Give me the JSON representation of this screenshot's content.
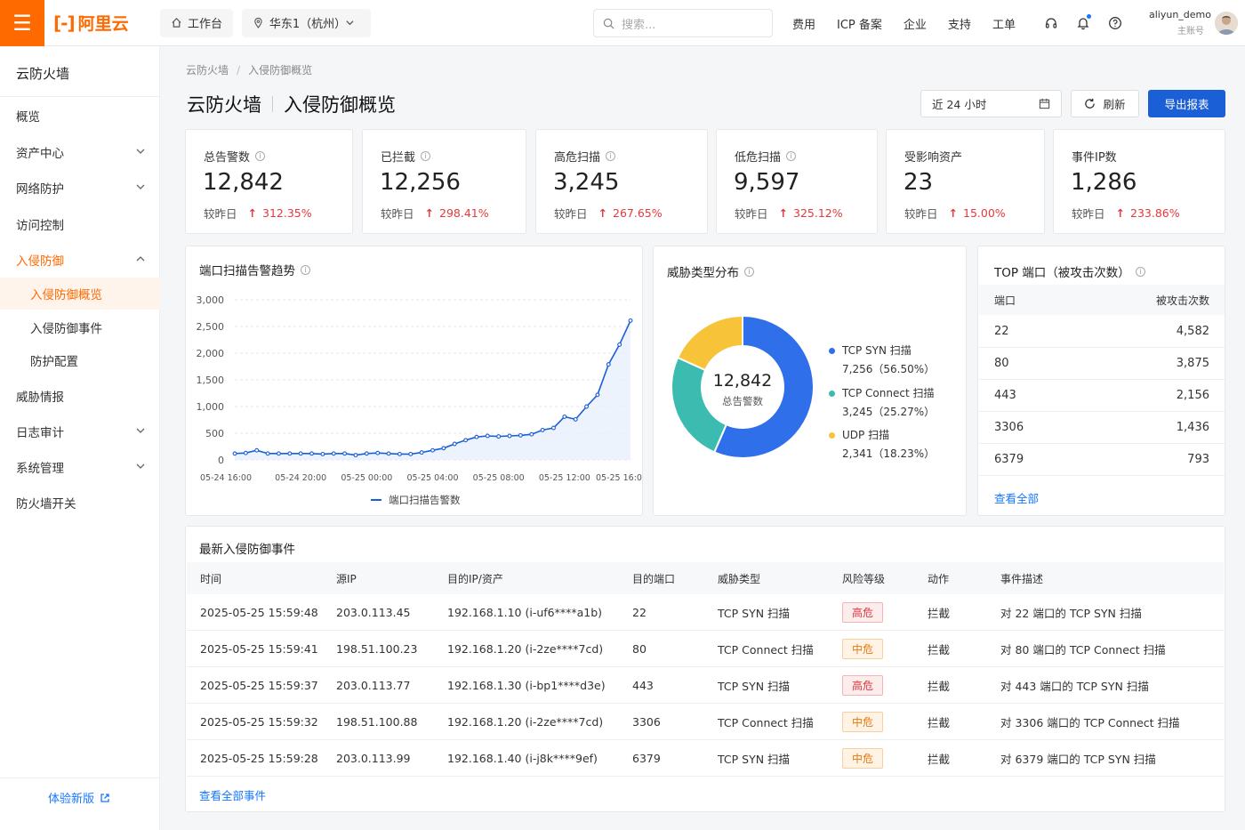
{
  "topbar": {
    "brand": "阿里云",
    "workbench": "工作台",
    "region": "华东1（杭州）",
    "search_placeholder": "搜索...",
    "nav": [
      "费用",
      "ICP 备案",
      "企业",
      "支持",
      "工单"
    ],
    "username": "aliyun_demo",
    "role": "主账号"
  },
  "sidebar": {
    "title": "云防火墙",
    "items": [
      {
        "label": "概览",
        "chevron": false
      },
      {
        "label": "资产中心",
        "chevron": true
      },
      {
        "label": "网络防护",
        "chevron": true
      },
      {
        "label": "访问控制",
        "chevron": false
      },
      {
        "label": "入侵防御",
        "chevron": true,
        "expanded": true
      },
      {
        "label": "入侵防御概览",
        "sub": true,
        "active": true
      },
      {
        "label": "入侵防御事件",
        "sub": true
      },
      {
        "label": "防护配置",
        "sub": true
      },
      {
        "label": "威胁情报",
        "chevron": false
      },
      {
        "label": "日志审计",
        "chevron": true
      },
      {
        "label": "系统管理",
        "chevron": true
      },
      {
        "label": "防火墙开关",
        "chevron": false
      }
    ],
    "new_version": "体验新版"
  },
  "breadcrumb": {
    "root": "云防火墙",
    "sep": "/",
    "current": "入侵防御概览"
  },
  "page_title": {
    "main": "云防火墙",
    "sub": "入侵防御概览"
  },
  "toolbar": {
    "range": "近 24 小时",
    "refresh": "刷新",
    "export": "导出报表"
  },
  "stats": [
    {
      "label": "总告警数",
      "info": true,
      "value": "12,842",
      "cmp": "较昨日",
      "change": "312.35%"
    },
    {
      "label": "已拦截",
      "info": true,
      "value": "12,256",
      "cmp": "较昨日",
      "change": "298.41%"
    },
    {
      "label": "高危扫描",
      "info": true,
      "value": "3,245",
      "cmp": "较昨日",
      "change": "267.65%"
    },
    {
      "label": "低危扫描",
      "info": true,
      "value": "9,597",
      "cmp": "较昨日",
      "change": "325.12%"
    },
    {
      "label": "受影响资产",
      "info": false,
      "value": "23",
      "cmp": "较昨日",
      "change": "15.00%"
    },
    {
      "label": "事件IP数",
      "info": false,
      "value": "1,286",
      "cmp": "较昨日",
      "change": "233.86%"
    }
  ],
  "trend": {
    "title": "端口扫描告警趋势"
  },
  "pie": {
    "title": "威胁类型分布",
    "center_value": "12,842",
    "center_label": "总告警数"
  },
  "top_ports": {
    "title": "TOP 端口（被攻击次数）",
    "col_port": "端口",
    "col_count": "被攻击次数",
    "rows": [
      {
        "port": "22",
        "count": "4,582"
      },
      {
        "port": "80",
        "count": "3,875"
      },
      {
        "port": "443",
        "count": "2,156"
      },
      {
        "port": "3306",
        "count": "1,436"
      },
      {
        "port": "6379",
        "count": "793"
      }
    ],
    "view_all": "查看全部"
  },
  "events": {
    "title": "最新入侵防御事件",
    "columns": [
      "时间",
      "源IP",
      "目的IP/资产",
      "目的端口",
      "威胁类型",
      "风险等级",
      "动作",
      "事件描述"
    ],
    "rows": [
      {
        "time": "2025-05-25 15:59:48",
        "src": "203.0.113.45",
        "dst": "192.168.1.10  (i-uf6****a1b)",
        "port": "22",
        "type": "TCP SYN 扫描",
        "risk": "高危",
        "level": "high",
        "action": "拦截",
        "desc": "对 22 端口的 TCP SYN 扫描"
      },
      {
        "time": "2025-05-25 15:59:41",
        "src": "198.51.100.23",
        "dst": "192.168.1.20  (i-2ze****7cd)",
        "port": "80",
        "type": "TCP Connect 扫描",
        "risk": "中危",
        "level": "mid",
        "action": "拦截",
        "desc": "对 80 端口的 TCP Connect 扫描"
      },
      {
        "time": "2025-05-25 15:59:37",
        "src": "203.0.113.77",
        "dst": "192.168.1.30  (i-bp1****d3e)",
        "port": "443",
        "type": "TCP SYN 扫描",
        "risk": "高危",
        "level": "high",
        "action": "拦截",
        "desc": "对 443 端口的 TCP SYN 扫描"
      },
      {
        "time": "2025-05-25 15:59:32",
        "src": "198.51.100.88",
        "dst": "192.168.1.20  (i-2ze****7cd)",
        "port": "3306",
        "type": "TCP Connect 扫描",
        "risk": "中危",
        "level": "mid",
        "action": "拦截",
        "desc": "对 3306 端口的 TCP Connect 扫描"
      },
      {
        "time": "2025-05-25 15:59:28",
        "src": "203.0.113.99",
        "dst": "192.168.1.40  (i-j8k****9ef)",
        "port": "6379",
        "type": "TCP SYN 扫描",
        "risk": "中危",
        "level": "mid",
        "action": "拦截",
        "desc": "对 6379 端口的 TCP SYN 扫描"
      }
    ],
    "view_all": "查看全部事件"
  },
  "colors": {
    "accent": "#ff6a00",
    "primary": "#1a5fd6",
    "tcp_syn": "#2f6fea",
    "tcp_connect": "#3cbcb0",
    "udp": "#f7c338",
    "danger": "#e4393c"
  },
  "chart_data": [
    {
      "type": "line",
      "x_ticks": [
        "05-24 16:00",
        "05-24 20:00",
        "05-25 00:00",
        "05-25 04:00",
        "05-25 08:00",
        "05-25 12:00",
        "05-25 16:00"
      ],
      "ylim": [
        0,
        3000
      ],
      "y_ticks": [
        "0",
        "500",
        "1,000",
        "1,500",
        "2,000",
        "2,500",
        "3,000"
      ],
      "grid": true,
      "series": [
        {
          "name": "端口扫描告警数",
          "values": [
            120,
            130,
            180,
            120,
            120,
            120,
            120,
            120,
            110,
            120,
            120,
            90,
            120,
            130,
            120,
            110,
            110,
            140,
            180,
            220,
            300,
            370,
            430,
            450,
            440,
            450,
            460,
            480,
            560,
            600,
            810,
            760,
            1000,
            1220,
            1790,
            2160,
            2610
          ]
        }
      ]
    },
    {
      "type": "pie",
      "title": "威胁类型分布",
      "total": 12842,
      "series": [
        {
          "name": "TCP SYN 扫描",
          "value": 7256,
          "pct": "56.50%",
          "color": "#2f6fea",
          "label": "7,256（56.50%）"
        },
        {
          "name": "TCP Connect 扫描",
          "value": 3245,
          "pct": "25.27%",
          "color": "#3cbcb0",
          "label": "3,245（25.27%）"
        },
        {
          "name": "UDP 扫描",
          "value": 2341,
          "pct": "18.23%",
          "color": "#f7c338",
          "label": "2,341（18.23%）"
        }
      ]
    }
  ]
}
